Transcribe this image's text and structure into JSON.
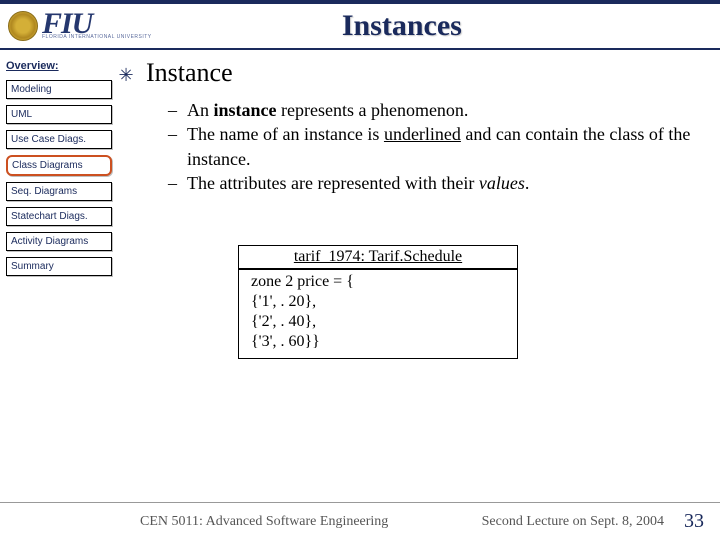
{
  "header": {
    "logo_main": "FIU",
    "logo_sub": "FLORIDA INTERNATIONAL UNIVERSITY",
    "title": "Instances"
  },
  "sidebar": {
    "label": "Overview:",
    "items": [
      {
        "label": "Modeling",
        "active": false
      },
      {
        "label": "UML",
        "active": false
      },
      {
        "label": "Use Case Diags.",
        "active": false
      },
      {
        "label": "Class Diagrams",
        "active": true
      },
      {
        "label": "Seq. Diagrams",
        "active": false
      },
      {
        "label": "Statechart Diags.",
        "active": false
      },
      {
        "label": "Activity Diagrams",
        "active": false
      },
      {
        "label": "Summary",
        "active": false
      }
    ]
  },
  "content": {
    "heading": "Instance",
    "sub1_pre": "An ",
    "sub1_bold": "instance",
    "sub1_post": " represents a phenomenon.",
    "sub2_pre": "The name of an instance is ",
    "sub2_ul": "underlined",
    "sub2_post": " and can contain the class of the instance.",
    "sub3_pre": "The attributes are represented with their ",
    "sub3_ital": "values",
    "sub3_post": "."
  },
  "uml": {
    "name": "tarif_1974: Tarif.Schedule",
    "line1": "zone 2 price = {",
    "line2": "{'1', . 20},",
    "line3": "{'2', . 40},",
    "line4": "{'3', . 60}}"
  },
  "footer": {
    "left": "CEN 5011: Advanced Software Engineering",
    "mid": "Second Lecture on Sept. 8, 2004",
    "num": "33"
  }
}
